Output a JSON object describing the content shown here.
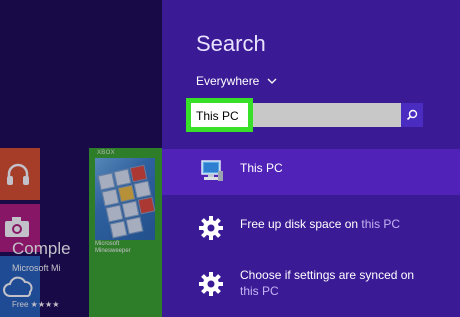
{
  "start": {
    "game_tile": {
      "badge": "XBOX",
      "logo_line1": "Microsoft",
      "logo_line2": "Minesweeper",
      "title": "Comple",
      "subtitle": "Microsoft Mi",
      "price": "Free ★★★★"
    }
  },
  "search": {
    "title": "Search",
    "scope": "Everywhere",
    "query": "This PC"
  },
  "results": [
    {
      "main": "This PC",
      "muted": "",
      "selected": true
    },
    {
      "main": "Free up disk space on ",
      "muted": "this PC",
      "selected": false
    },
    {
      "main": "Choose if settings are synced on",
      "muted": "this PC",
      "selected": false
    }
  ],
  "colors": {
    "pane_bg": "#3b1a96",
    "selected_bg": "#5022b8",
    "highlight_border": "#39e02a",
    "search_button": "#4a2cc0"
  }
}
